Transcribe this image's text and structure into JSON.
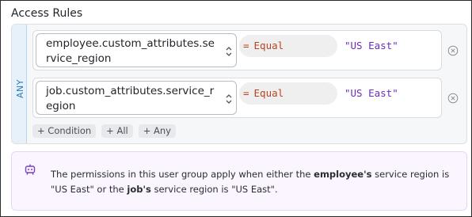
{
  "section_title": "Access Rules",
  "group_mode": "ANY",
  "conditions": [
    {
      "attribute": "employee.custom_attributes.service_region",
      "operator_symbol": "=",
      "operator_label": "Equal",
      "value": "\"US East\""
    },
    {
      "attribute": "job.custom_attributes.service_region",
      "operator_symbol": "=",
      "operator_label": "Equal",
      "value": "\"US East\""
    }
  ],
  "add_buttons": {
    "condition": "+ Condition",
    "all": "+ All",
    "any": "+ Any"
  },
  "info": {
    "text_1": "The permissions in this user group apply when either the ",
    "bold_1": "employee's",
    "text_2": " service region is \"US East\" or the ",
    "bold_2": "job's",
    "text_3": " service region is \"US East\"."
  },
  "colors": {
    "operator": "#b5471e",
    "value": "#6a2dbb",
    "any_label": "#2b7bb9",
    "info_bg": "#faf5fe",
    "bot_icon": "#7b3fc4"
  }
}
